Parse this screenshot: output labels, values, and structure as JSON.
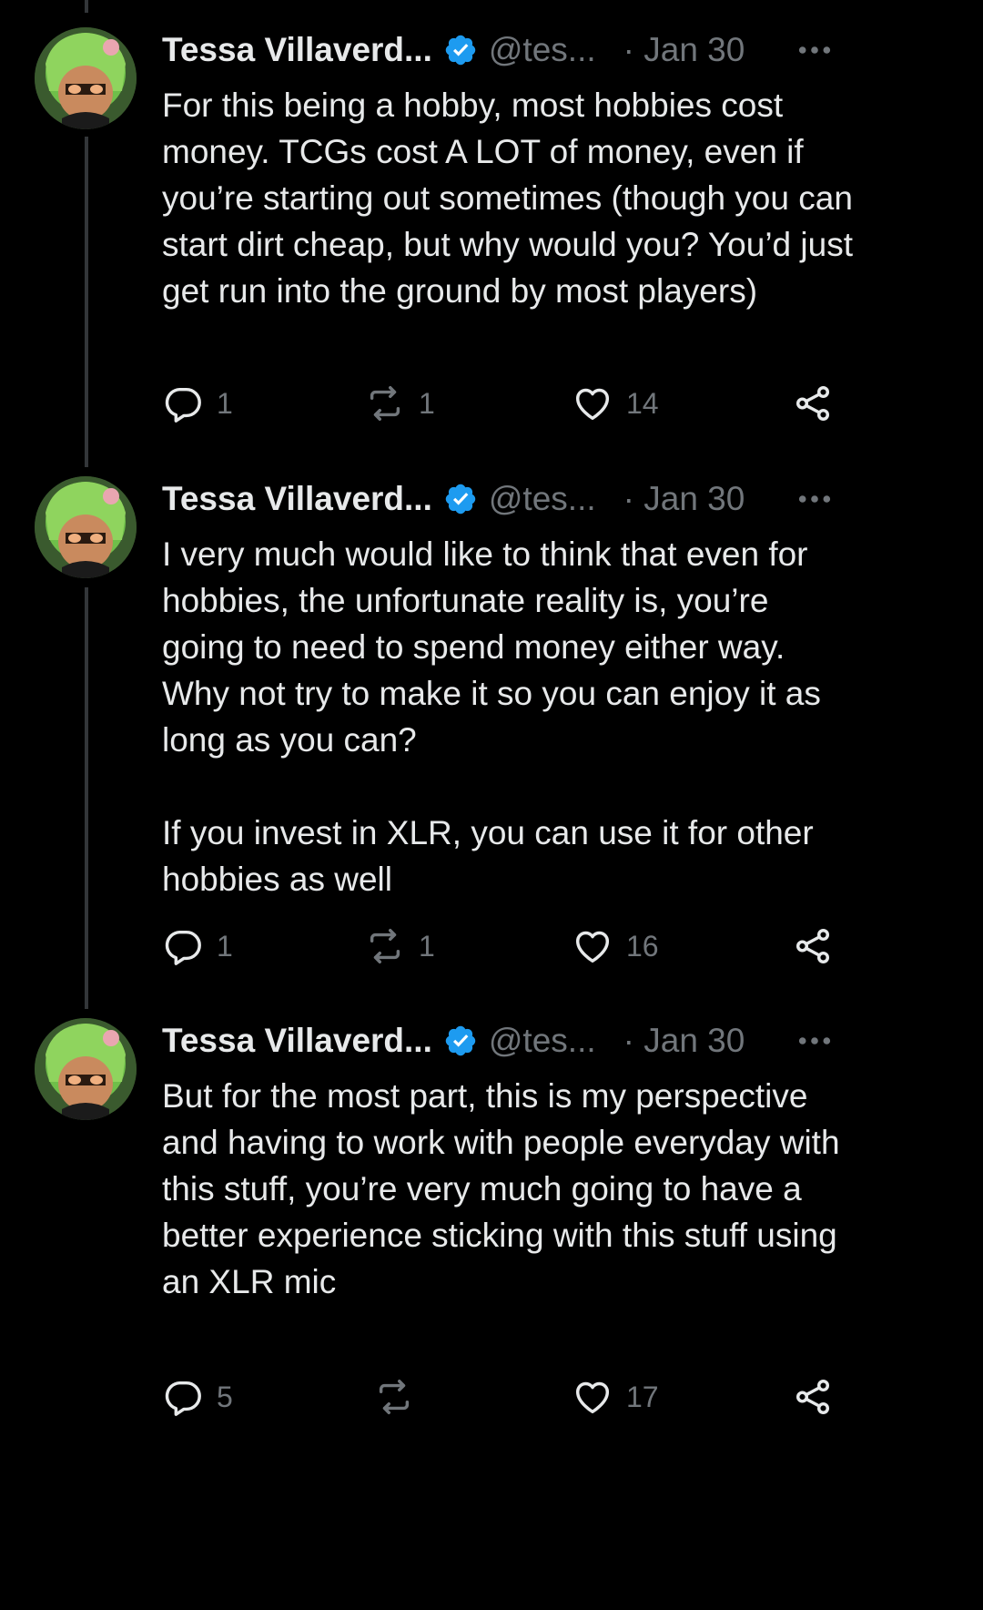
{
  "tweets": [
    {
      "author_name": "Tessa Villaverd...",
      "handle": "@tes...",
      "date": "· Jan 30",
      "text": "For this being a hobby, most hobbies cost money. TCGs cost A LOT of money, even if you’re starting out sometimes (though you can start dirt cheap, but why would you? You’d just get run into the ground by most players)",
      "replies": "1",
      "reposts": "1",
      "likes": "14"
    },
    {
      "author_name": "Tessa Villaverd...",
      "handle": "@tes...",
      "date": "· Jan 30",
      "text": "I very much would like to think that even for hobbies, the unfortunate reality is, you’re going to need to spend money either way. Why not try to make it so you can enjoy it as long as you can?\n\nIf you invest in XLR, you can use it for other hobbies as well",
      "replies": "1",
      "reposts": "1",
      "likes": "16"
    },
    {
      "author_name": "Tessa Villaverd...",
      "handle": "@tes...",
      "date": "· Jan 30",
      "text": "But for the most part, this is my perspective and having to work with people everyday with this stuff, you’re very much going to have a better experience sticking with this stuff using an XLR mic",
      "replies": "5",
      "reposts": "",
      "likes": "17"
    }
  ],
  "icons": {
    "verified": "verified-badge-icon",
    "more": "more-dots-icon",
    "reply": "reply-icon",
    "repost": "repost-icon",
    "like": "heart-icon",
    "share": "share-icon"
  },
  "colors": {
    "background": "#000000",
    "text": "#e7e9ea",
    "muted": "#71767b",
    "verified": "#1d9bf0",
    "thread_line": "#333639"
  }
}
